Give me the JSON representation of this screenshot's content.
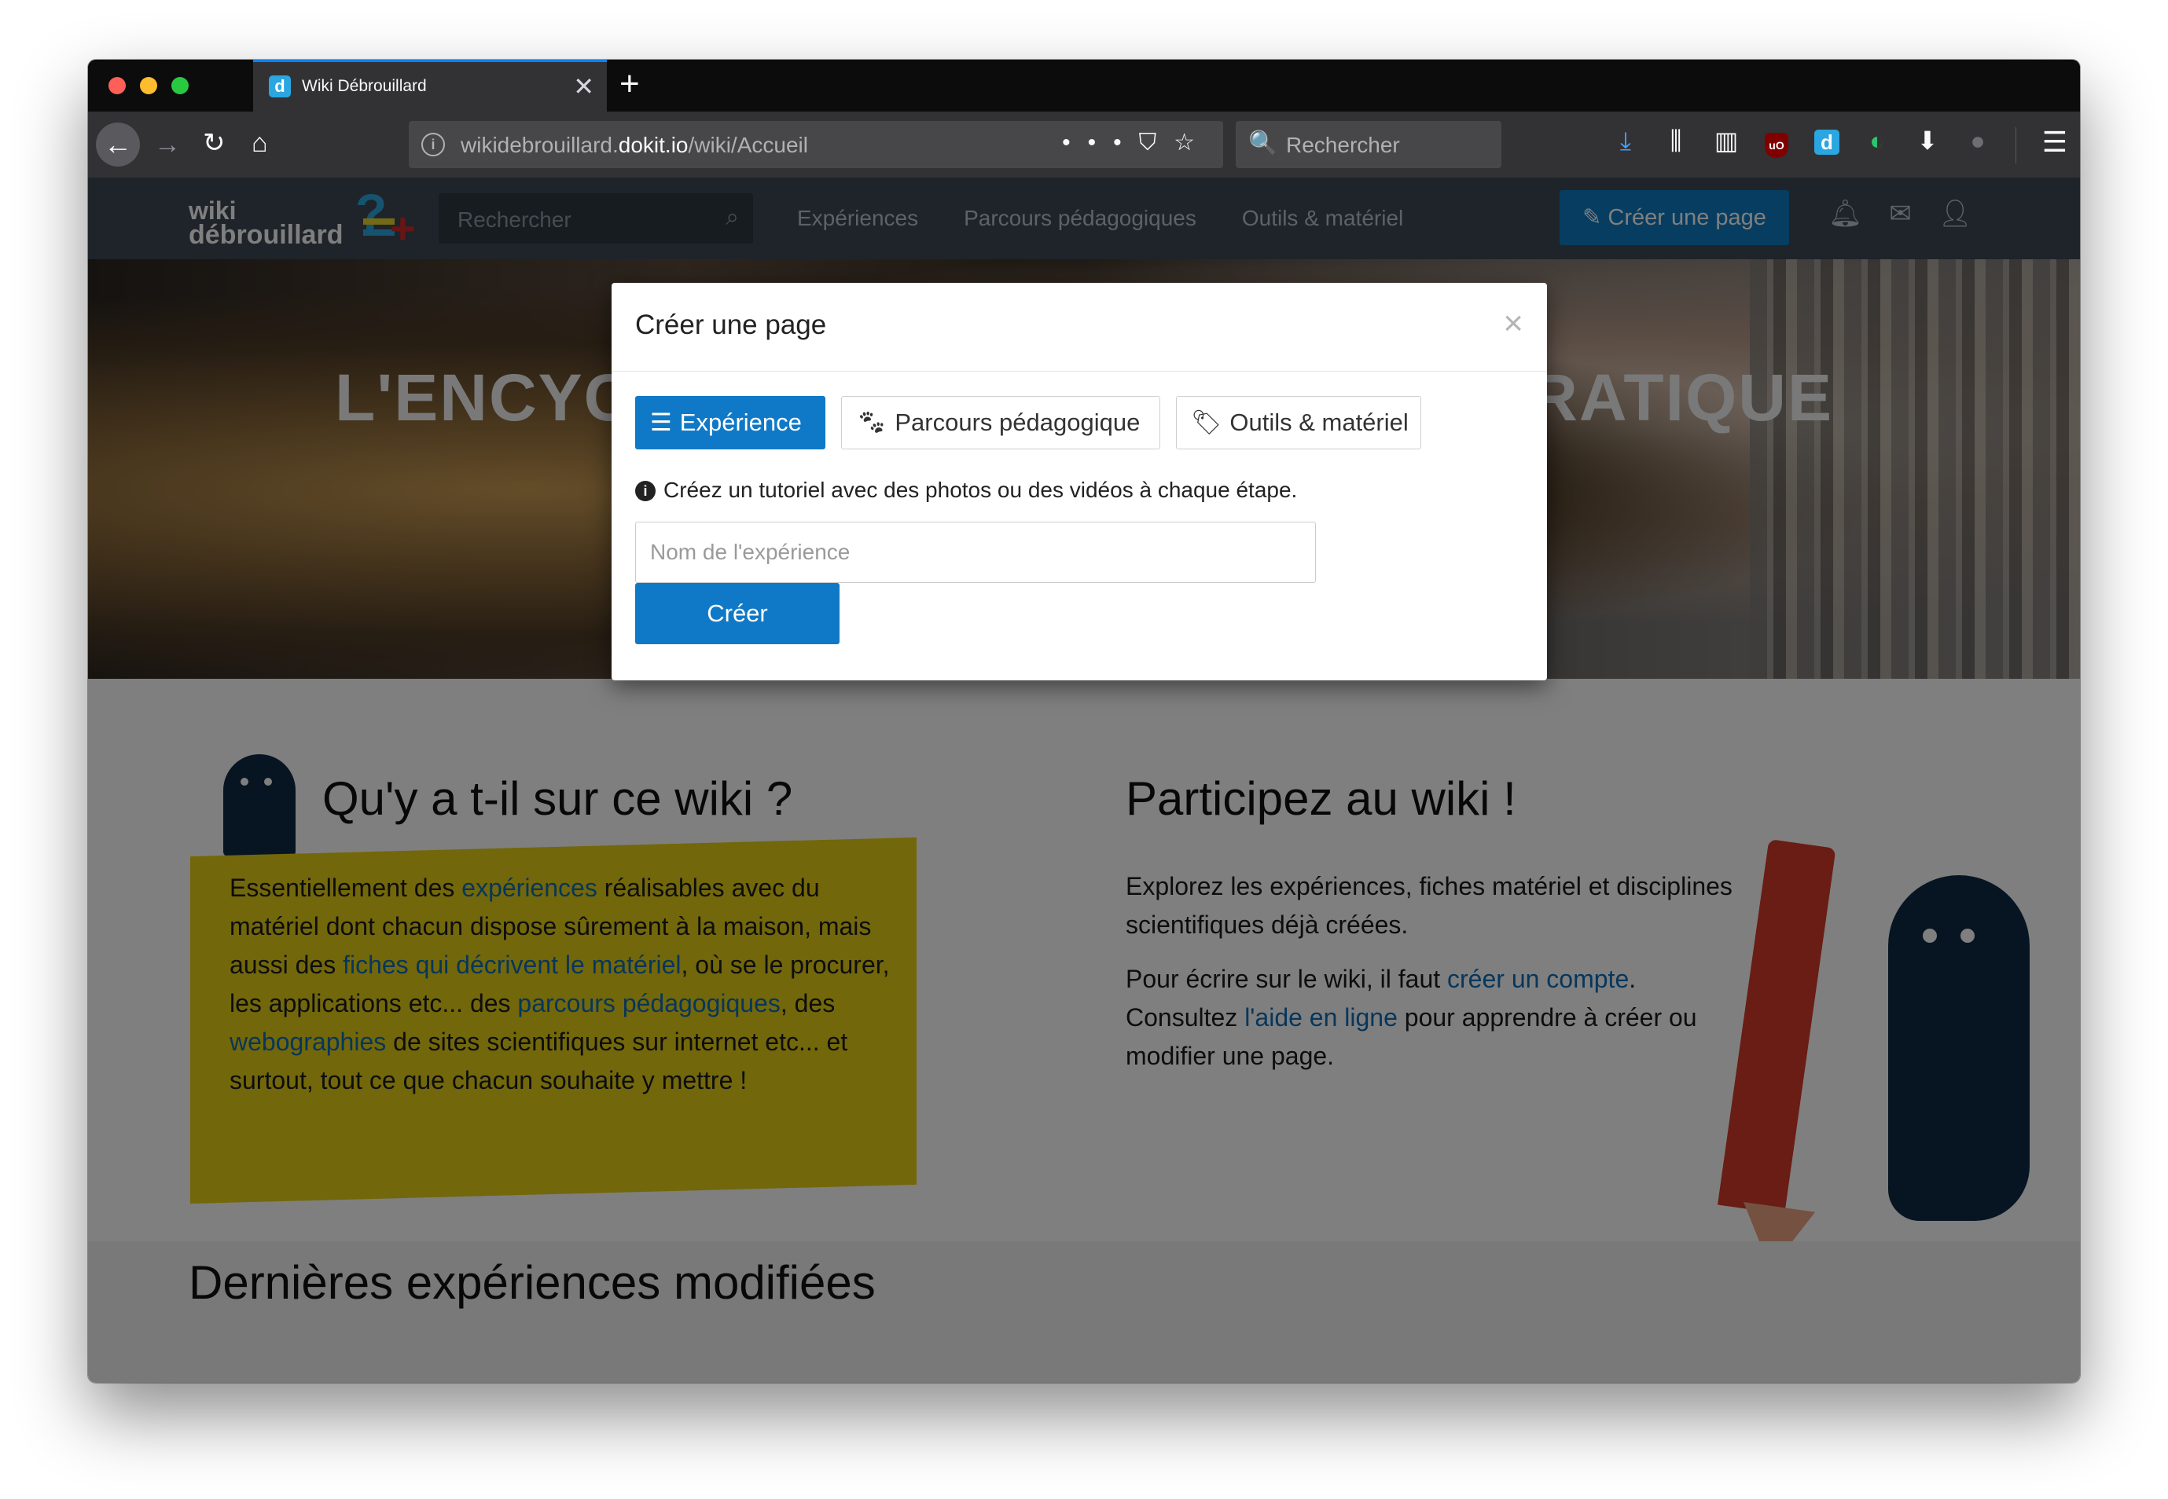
{
  "browser": {
    "tab_title": "Wiki Débrouillard",
    "tab_favicon": "d",
    "url_base": "wikidebrouillard.",
    "url_host": "dokit.io",
    "url_path": "/wiki/Accueil",
    "search_placeholder": "Rechercher"
  },
  "site": {
    "logo_line1": "wiki",
    "logo_line2": "débrouillard",
    "search_placeholder": "Rechercher",
    "nav_links": [
      "Expériences",
      "Parcours pédagogiques",
      "Outils & matériel"
    ],
    "create_button": "Créer une page",
    "hero_title": "L'ENCYCLOPÉDIE DES SCIENCES PRATIQUE"
  },
  "modal": {
    "title": "Créer une page",
    "close": "×",
    "tabs": [
      {
        "label": "Expérience",
        "icon": "list-icon",
        "active": true
      },
      {
        "label": "Parcours pédagogique",
        "icon": "paw-icon",
        "active": false
      },
      {
        "label": "Outils & matériel",
        "icon": "tag-icon",
        "active": false
      }
    ],
    "info_text": "Créez un tutoriel avec des photos ou des vidéos à chaque étape.",
    "input_placeholder": "Nom de l'expérience",
    "submit_label": "Créer"
  },
  "left_section": {
    "title": "Qu'y a t-il sur ce wiki ?",
    "text_1": "Essentiellement des ",
    "link_1": "expériences",
    "text_2": " réalisables avec du matériel dont chacun dispose sûrement à la maison, mais aussi des ",
    "link_2": "fiches qui décrivent le matériel",
    "text_3": ", où se le procurer, les applications etc... des ",
    "link_3": "parcours pédagogiques",
    "text_4": ", des ",
    "link_4": "webographies",
    "text_5": " de sites scientifiques sur internet etc... et surtout, tout ce que chacun souhaite y mettre !"
  },
  "right_section": {
    "title": "Participez au wiki !",
    "para_1": "Explorez les expériences, fiches matériel et disciplines scientifiques déjà créées.",
    "p2_text_1": "Pour écrire sur le wiki, il faut ",
    "p2_link_1": "créer un compte",
    "p2_text_2": ". Consultez ",
    "p2_link_2": "l'aide en ligne",
    "p2_text_3": " pour apprendre à créer ou modifier une page."
  },
  "bottom_section": {
    "title": "Dernières expériences modifiées"
  },
  "colors": {
    "accent_blue": "#1079c7",
    "nav_bg": "#3d4852",
    "highlight_yellow": "#e5ce16",
    "link_blue": "#0f6cb6"
  }
}
